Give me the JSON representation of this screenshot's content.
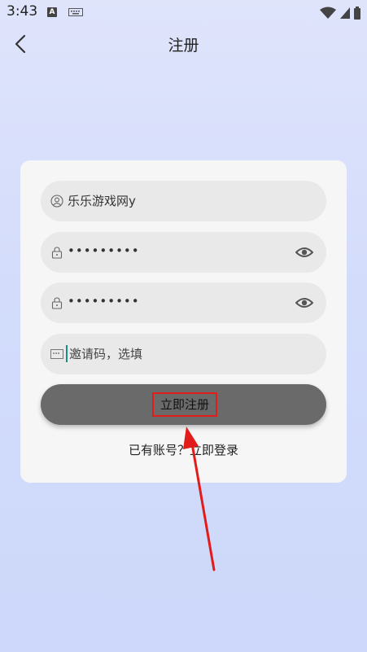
{
  "status_bar": {
    "time": "3:43",
    "notification_icon_letter": "A"
  },
  "header": {
    "title": "注册"
  },
  "form": {
    "username": {
      "value": "乐乐游戏网y"
    },
    "password": {
      "value": "•••••••••"
    },
    "confirm_password": {
      "value": "•••••••••"
    },
    "invite_code": {
      "placeholder": "邀请码，选填"
    },
    "submit_label": "立即注册",
    "login_link": "已有账号？立即登录"
  },
  "colors": {
    "background": "#d3dcfb",
    "card": "#f6f6f6",
    "field": "#e9e9e9",
    "submit_button": "#6b6a6b",
    "highlight": "#e21b1b",
    "cursor": "#1a8f7f"
  }
}
